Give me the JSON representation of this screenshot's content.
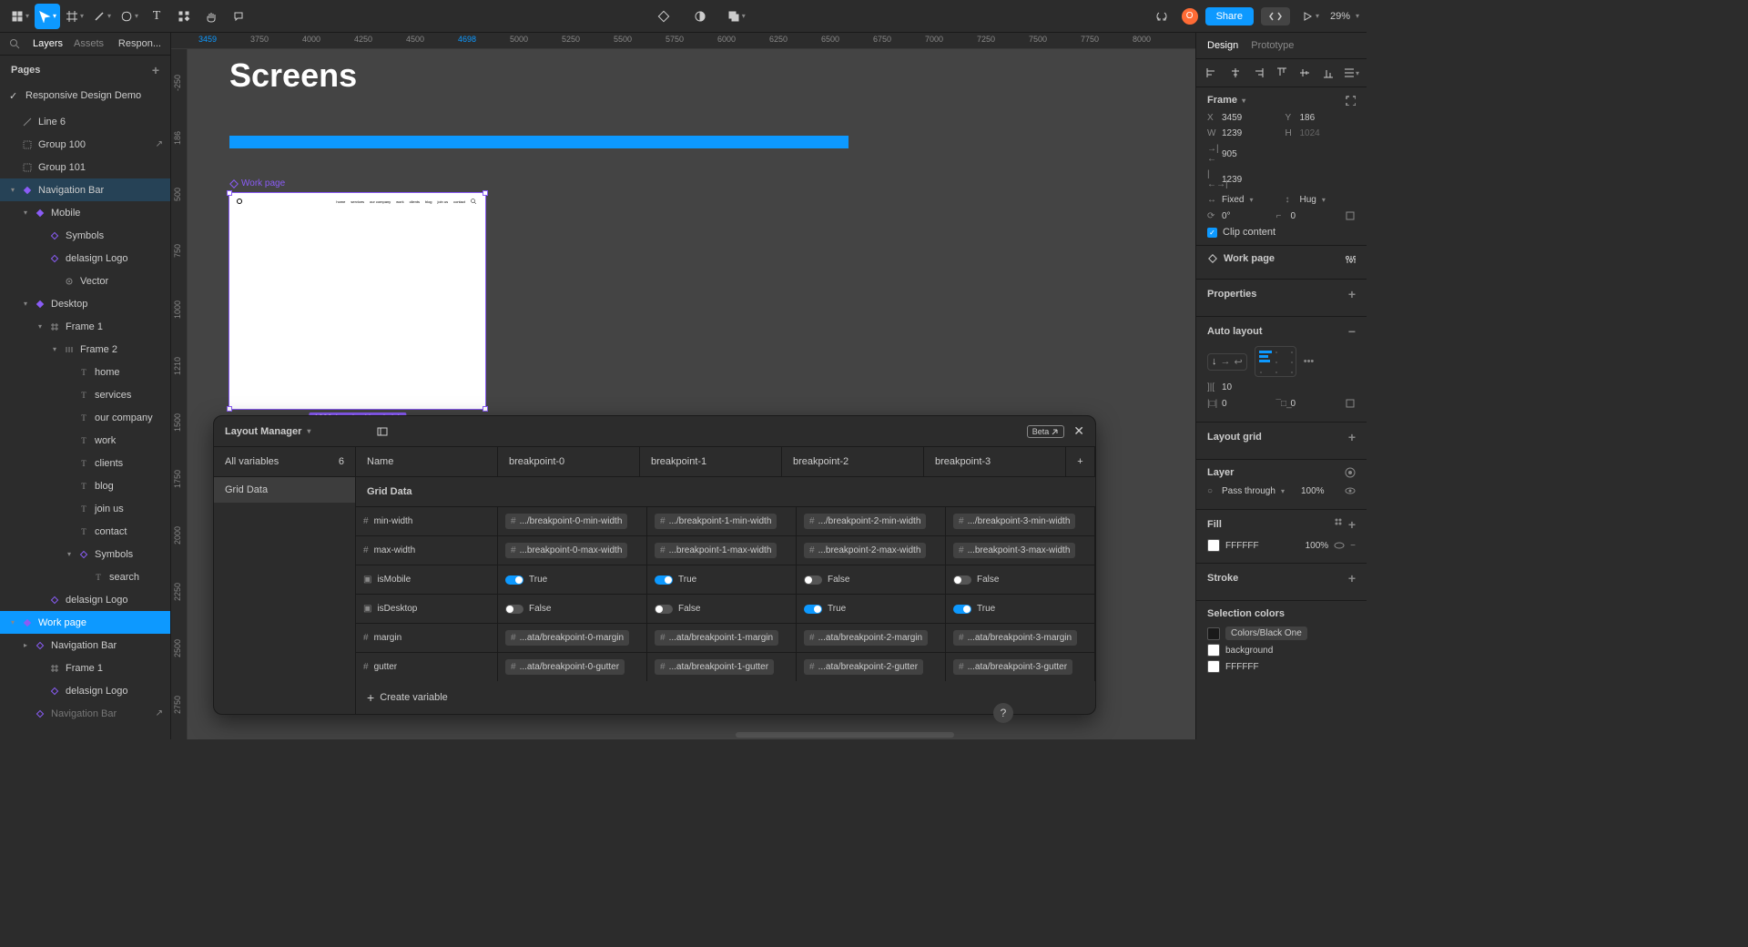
{
  "toolbar": {
    "zoom": "29%",
    "share": "Share",
    "avatar": "O"
  },
  "leftPanel": {
    "tabs": {
      "layers": "Layers",
      "assets": "Assets"
    },
    "filename": "Respon...",
    "pages": {
      "title": "Pages",
      "item": "Responsive Design Demo"
    },
    "layers": [
      {
        "label": "Line 6",
        "depth": 0,
        "icon": "line"
      },
      {
        "label": "Group 100",
        "depth": 0,
        "icon": "group",
        "action": "arrow"
      },
      {
        "label": "Group 101",
        "depth": 0,
        "icon": "group"
      },
      {
        "label": "Navigation Bar",
        "depth": 0,
        "icon": "comp",
        "sel": "selected",
        "toggle": "▾"
      },
      {
        "label": "Mobile",
        "depth": 1,
        "icon": "diamond",
        "toggle": "▾"
      },
      {
        "label": "Symbols",
        "depth": 2,
        "icon": "diamond-o"
      },
      {
        "label": "delasign Logo",
        "depth": 2,
        "icon": "diamond-o"
      },
      {
        "label": "Vector",
        "depth": 3,
        "icon": "vector"
      },
      {
        "label": "Desktop",
        "depth": 1,
        "icon": "diamond",
        "toggle": "▾"
      },
      {
        "label": "Frame 1",
        "depth": 2,
        "icon": "frame",
        "toggle": "▾"
      },
      {
        "label": "Frame 2",
        "depth": 3,
        "icon": "autolayout",
        "toggle": "▾"
      },
      {
        "label": "home",
        "depth": 4,
        "icon": "text"
      },
      {
        "label": "services",
        "depth": 4,
        "icon": "text"
      },
      {
        "label": "our company",
        "depth": 4,
        "icon": "text"
      },
      {
        "label": "work",
        "depth": 4,
        "icon": "text"
      },
      {
        "label": "clients",
        "depth": 4,
        "icon": "text"
      },
      {
        "label": "blog",
        "depth": 4,
        "icon": "text"
      },
      {
        "label": "join us",
        "depth": 4,
        "icon": "text"
      },
      {
        "label": "contact",
        "depth": 4,
        "icon": "text"
      },
      {
        "label": "Symbols",
        "depth": 4,
        "icon": "diamond-o",
        "toggle": "▾"
      },
      {
        "label": "search",
        "depth": 5,
        "icon": "text"
      },
      {
        "label": "delasign Logo",
        "depth": 2,
        "icon": "diamond-o"
      },
      {
        "label": "Work page",
        "depth": 0,
        "icon": "comp",
        "sel": "sel-strong",
        "toggle": "▾"
      },
      {
        "label": "Navigation Bar",
        "depth": 1,
        "icon": "diamond-o",
        "toggle": "▸"
      },
      {
        "label": "Frame 1",
        "depth": 2,
        "icon": "frame"
      },
      {
        "label": "delasign Logo",
        "depth": 2,
        "icon": "diamond-o"
      },
      {
        "label": "Navigation Bar",
        "depth": 1,
        "icon": "diamond-o",
        "dim": true,
        "action": "arrow"
      }
    ]
  },
  "canvas": {
    "ticksX": [
      "3459",
      "3750",
      "4000",
      "4250",
      "4500",
      "4698",
      "5000",
      "5250",
      "5500",
      "5750",
      "6000",
      "6250",
      "6500",
      "6750",
      "7000",
      "7250",
      "7500",
      "7750",
      "8000"
    ],
    "ticksXHighlight": [
      0,
      5
    ],
    "ticksY": [
      "-250",
      "186",
      "500",
      "750",
      "1000",
      "1210",
      "1500",
      "1750",
      "2000",
      "2250",
      "2500",
      "2750"
    ],
    "ticksYHighlight": [
      1,
      5
    ],
    "title": "Screens",
    "frameLabel": "Work page",
    "frameNav": [
      "home",
      "services",
      "our company",
      "work",
      "clients",
      "blog",
      "join us",
      "contact"
    ],
    "sizing": "1239 (max) × Hug (min)"
  },
  "varPanel": {
    "title": "Layout Manager",
    "beta": "Beta",
    "side": {
      "allVars": "All variables",
      "count": "6",
      "group": "Grid Data"
    },
    "caption": "Grid Data",
    "headers": [
      "Name",
      "breakpoint-0",
      "breakpoint-1",
      "breakpoint-2",
      "breakpoint-3"
    ],
    "rows": [
      {
        "type": "num",
        "name": "min-width",
        "vals": [
          ".../breakpoint-0-min-width",
          ".../breakpoint-1-min-width",
          ".../breakpoint-2-min-width",
          ".../breakpoint-3-min-width"
        ]
      },
      {
        "type": "num",
        "name": "max-width",
        "vals": [
          "...breakpoint-0-max-width",
          "...breakpoint-1-max-width",
          "...breakpoint-2-max-width",
          "...breakpoint-3-max-width"
        ]
      },
      {
        "type": "bool",
        "name": "isMobile",
        "vals": [
          true,
          true,
          false,
          false
        ]
      },
      {
        "type": "bool",
        "name": "isDesktop",
        "vals": [
          false,
          false,
          true,
          true
        ]
      },
      {
        "type": "num",
        "name": "margin",
        "vals": [
          "...ata/breakpoint-0-margin",
          "...ata/breakpoint-1-margin",
          "...ata/breakpoint-2-margin",
          "...ata/breakpoint-3-margin"
        ]
      },
      {
        "type": "num",
        "name": "gutter",
        "vals": [
          "...ata/breakpoint-0-gutter",
          "...ata/breakpoint-1-gutter",
          "...ata/breakpoint-2-gutter",
          "...ata/breakpoint-3-gutter"
        ]
      }
    ],
    "boolTrue": "True",
    "boolFalse": "False",
    "create": "Create variable"
  },
  "rightPanel": {
    "tabs": {
      "design": "Design",
      "prototype": "Prototype"
    },
    "frame": "Frame",
    "x": "3459",
    "y": "186",
    "w": "1239",
    "h": "1024",
    "min": "905",
    "max": "1239",
    "resizeW": "Fixed",
    "resizeH": "Hug",
    "rotation": "0°",
    "radius": "0",
    "clip": "Clip content",
    "workpage": "Work page",
    "properties": "Properties",
    "autolayout": "Auto layout",
    "gap": "10",
    "padH": "0",
    "padV": "0",
    "layoutgrid": "Layout grid",
    "layer": "Layer",
    "blend": "Pass through",
    "opacity": "100%",
    "fill": "Fill",
    "fillColor": "FFFFFF",
    "fillOpacity": "100%",
    "stroke": "Stroke",
    "selColors": "Selection colors",
    "selC1": "Colors/Black One",
    "selC2": "background",
    "selC3": "FFFFFF"
  }
}
